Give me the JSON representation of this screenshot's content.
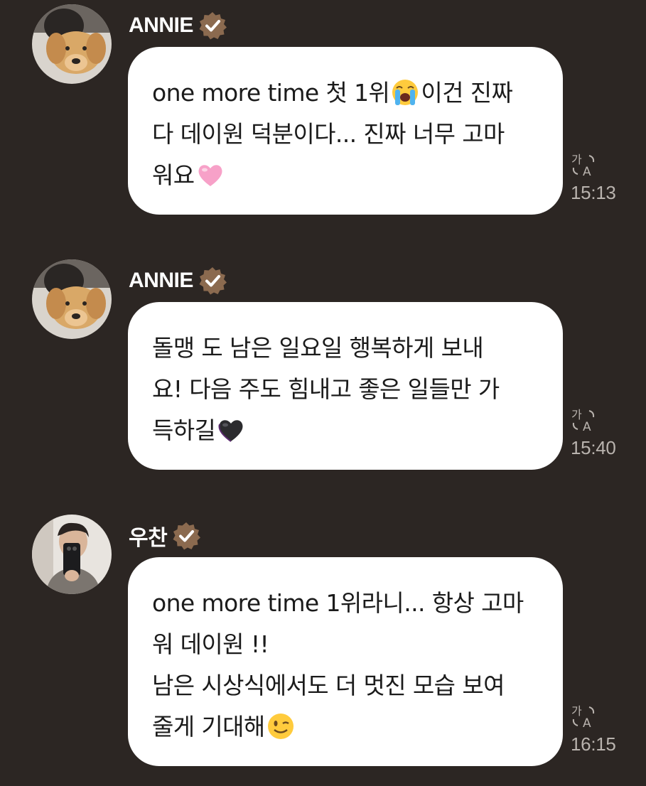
{
  "messages": [
    {
      "sender": "ANNIE",
      "avatar": "golden-retriever-puppy-photo",
      "lines": [
        "one more time 첫 1위",
        "다 데이원 덕분이다... 진짜 너무 고마",
        "워요"
      ],
      "line1_tail": "이건 진짜",
      "emoji_1": "loudly-crying-face",
      "emoji_3": "pink-heart",
      "time": "15:13"
    },
    {
      "sender": "ANNIE",
      "avatar": "golden-retriever-puppy-photo",
      "lines": [
        "돌맹 도 남은 일요일 행복하게 보내",
        "요! 다음 주도 힘내고 좋은 일들만 가",
        "득하길"
      ],
      "emoji_3": "black-heart",
      "time": "15:40"
    },
    {
      "sender": "우찬",
      "avatar": "mirror-selfie-photo",
      "lines": [
        "one more time 1위라니... 항상 고마",
        "워 데이원 !!",
        "남은 시상식에서도 더 멋진 모습 보여",
        "줄게 기대해"
      ],
      "emoji_4": "winking-face",
      "time": "16:15"
    }
  ],
  "colors": {
    "background": "#2c2623",
    "bubble": "#ffffff",
    "verified_badge": "#8b6a4f",
    "timestamp": "#b9b3ae"
  }
}
